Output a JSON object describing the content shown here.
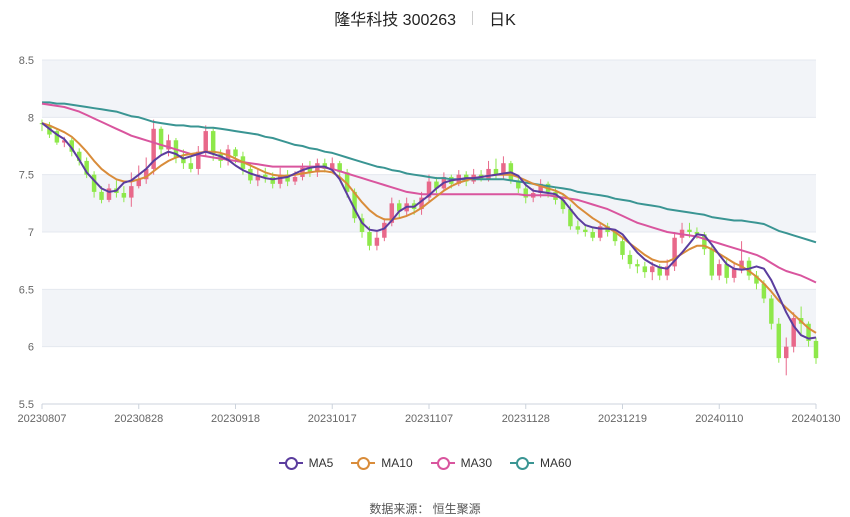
{
  "header": {
    "title": "隆华科技 300263",
    "period": "日K"
  },
  "source_text": "数据来源： 恒生聚源",
  "colors": {
    "up": "#e8688a",
    "down": "#8ee84a",
    "ma5": "#5b3d9e",
    "ma10": "#d98c3a",
    "ma30": "#d9559e",
    "ma60": "#3a9593",
    "band": "#f2f4f8",
    "grid": "#e4e8ef"
  },
  "chart_data": {
    "type": "candlestick",
    "title": "隆华科技 300263",
    "ylim": [
      5.5,
      8.5
    ],
    "yticks": [
      "5.5",
      "6",
      "6.5",
      "7",
      "7.5",
      "8",
      "8.5"
    ],
    "xtick_labels": [
      "20230807",
      "20230828",
      "20230918",
      "20231017",
      "20231107",
      "20231128",
      "20231219",
      "20240110",
      "20240130"
    ],
    "legend": [
      "MA5",
      "MA10",
      "MA30",
      "MA60"
    ],
    "candles": [
      [
        7.95,
        7.94,
        7.98,
        7.88
      ],
      [
        7.93,
        7.85,
        7.96,
        7.82
      ],
      [
        7.88,
        7.78,
        7.9,
        7.76
      ],
      [
        7.78,
        7.8,
        7.83,
        7.74
      ],
      [
        7.8,
        7.7,
        7.82,
        7.66
      ],
      [
        7.7,
        7.62,
        7.73,
        7.58
      ],
      [
        7.62,
        7.5,
        7.65,
        7.47
      ],
      [
        7.5,
        7.35,
        7.53,
        7.3
      ],
      [
        7.35,
        7.28,
        7.4,
        7.25
      ],
      [
        7.28,
        7.38,
        7.42,
        7.26
      ],
      [
        7.38,
        7.34,
        7.45,
        7.3
      ],
      [
        7.34,
        7.3,
        7.4,
        7.26
      ],
      [
        7.3,
        7.4,
        7.52,
        7.22
      ],
      [
        7.4,
        7.46,
        7.58,
        7.38
      ],
      [
        7.46,
        7.55,
        7.65,
        7.42
      ],
      [
        7.55,
        7.9,
        7.98,
        7.5
      ],
      [
        7.9,
        7.72,
        7.92,
        7.68
      ],
      [
        7.72,
        7.8,
        7.85,
        7.66
      ],
      [
        7.8,
        7.65,
        7.82,
        7.6
      ],
      [
        7.65,
        7.6,
        7.72,
        7.55
      ],
      [
        7.6,
        7.55,
        7.66,
        7.52
      ],
      [
        7.55,
        7.7,
        7.75,
        7.5
      ],
      [
        7.7,
        7.88,
        7.93,
        7.66
      ],
      [
        7.88,
        7.68,
        7.9,
        7.62
      ],
      [
        7.68,
        7.62,
        7.72,
        7.56
      ],
      [
        7.62,
        7.72,
        7.76,
        7.58
      ],
      [
        7.72,
        7.66,
        7.74,
        7.6
      ],
      [
        7.66,
        7.55,
        7.7,
        7.5
      ],
      [
        7.55,
        7.45,
        7.6,
        7.42
      ],
      [
        7.45,
        7.5,
        7.55,
        7.4
      ],
      [
        7.5,
        7.48,
        7.56,
        7.43
      ],
      [
        7.48,
        7.42,
        7.52,
        7.38
      ],
      [
        7.42,
        7.5,
        7.56,
        7.38
      ],
      [
        7.5,
        7.44,
        7.54,
        7.4
      ],
      [
        7.44,
        7.48,
        7.53,
        7.41
      ],
      [
        7.48,
        7.56,
        7.6,
        7.45
      ],
      [
        7.56,
        7.52,
        7.62,
        7.48
      ],
      [
        7.52,
        7.6,
        7.64,
        7.48
      ],
      [
        7.6,
        7.55,
        7.64,
        7.52
      ],
      [
        7.55,
        7.6,
        7.65,
        7.52
      ],
      [
        7.6,
        7.52,
        7.62,
        7.48
      ],
      [
        7.52,
        7.35,
        7.55,
        7.3
      ],
      [
        7.35,
        7.12,
        7.38,
        7.08
      ],
      [
        7.12,
        7.0,
        7.16,
        6.95
      ],
      [
        7.0,
        6.88,
        7.05,
        6.84
      ],
      [
        6.88,
        6.95,
        7.0,
        6.84
      ],
      [
        6.95,
        7.08,
        7.12,
        6.92
      ],
      [
        7.08,
        7.25,
        7.3,
        7.05
      ],
      [
        7.25,
        7.18,
        7.28,
        7.12
      ],
      [
        7.18,
        7.25,
        7.3,
        7.14
      ],
      [
        7.25,
        7.2,
        7.28,
        7.15
      ],
      [
        7.2,
        7.3,
        7.35,
        7.15
      ],
      [
        7.3,
        7.44,
        7.5,
        7.26
      ],
      [
        7.44,
        7.38,
        7.48,
        7.34
      ],
      [
        7.38,
        7.48,
        7.52,
        7.36
      ],
      [
        7.48,
        7.42,
        7.5,
        7.38
      ],
      [
        7.42,
        7.5,
        7.54,
        7.4
      ],
      [
        7.5,
        7.44,
        7.53,
        7.4
      ],
      [
        7.44,
        7.5,
        7.55,
        7.42
      ],
      [
        7.5,
        7.46,
        7.54,
        7.44
      ],
      [
        7.46,
        7.55,
        7.62,
        7.44
      ],
      [
        7.55,
        7.5,
        7.64,
        7.46
      ],
      [
        7.5,
        7.6,
        7.66,
        7.46
      ],
      [
        7.6,
        7.45,
        7.62,
        7.42
      ],
      [
        7.45,
        7.38,
        7.48,
        7.34
      ],
      [
        7.38,
        7.3,
        7.42,
        7.25
      ],
      [
        7.3,
        7.34,
        7.38,
        7.26
      ],
      [
        7.34,
        7.42,
        7.46,
        7.3
      ],
      [
        7.42,
        7.35,
        7.44,
        7.3
      ],
      [
        7.35,
        7.28,
        7.38,
        7.24
      ],
      [
        7.28,
        7.2,
        7.32,
        7.16
      ],
      [
        7.2,
        7.05,
        7.24,
        7.02
      ],
      [
        7.05,
        7.02,
        7.1,
        6.98
      ],
      [
        7.02,
        7.0,
        7.06,
        6.96
      ],
      [
        7.0,
        6.95,
        7.04,
        6.92
      ],
      [
        6.95,
        7.05,
        7.08,
        6.92
      ],
      [
        7.05,
        7.0,
        7.08,
        6.96
      ],
      [
        7.0,
        6.92,
        7.02,
        6.88
      ],
      [
        6.92,
        6.8,
        6.95,
        6.76
      ],
      [
        6.8,
        6.72,
        6.84,
        6.68
      ],
      [
        6.72,
        6.7,
        6.76,
        6.64
      ],
      [
        6.7,
        6.65,
        6.74,
        6.6
      ],
      [
        6.65,
        6.7,
        6.74,
        6.58
      ],
      [
        6.7,
        6.62,
        6.72,
        6.58
      ],
      [
        6.62,
        6.7,
        6.76,
        6.58
      ],
      [
        6.7,
        6.95,
        7.0,
        6.66
      ],
      [
        6.95,
        7.02,
        7.08,
        6.9
      ],
      [
        7.02,
        7.0,
        7.08,
        6.95
      ],
      [
        7.0,
        6.98,
        7.04,
        6.94
      ],
      [
        6.98,
        6.85,
        7.0,
        6.8
      ],
      [
        6.85,
        6.62,
        6.88,
        6.58
      ],
      [
        6.62,
        6.72,
        6.76,
        6.58
      ],
      [
        6.72,
        6.6,
        6.78,
        6.55
      ],
      [
        6.6,
        6.68,
        6.74,
        6.56
      ],
      [
        6.68,
        6.75,
        6.92,
        6.64
      ],
      [
        6.75,
        6.62,
        6.78,
        6.58
      ],
      [
        6.62,
        6.55,
        6.66,
        6.5
      ],
      [
        6.55,
        6.42,
        6.58,
        6.38
      ],
      [
        6.42,
        6.2,
        6.45,
        6.15
      ],
      [
        6.2,
        5.9,
        6.25,
        5.86
      ],
      [
        5.9,
        6.0,
        6.08,
        5.75
      ],
      [
        6.0,
        6.25,
        6.3,
        5.95
      ],
      [
        6.25,
        6.2,
        6.35,
        6.1
      ],
      [
        6.2,
        6.05,
        6.22,
        6.0
      ],
      [
        6.05,
        5.9,
        6.08,
        5.85
      ]
    ],
    "ma5": [
      7.95,
      7.9,
      7.85,
      7.81,
      7.73,
      7.63,
      7.52,
      7.45,
      7.38,
      7.35,
      7.36,
      7.43,
      7.45,
      7.5,
      7.55,
      7.62,
      7.67,
      7.7,
      7.68,
      7.64,
      7.66,
      7.68,
      7.7,
      7.68,
      7.66,
      7.63,
      7.58,
      7.54,
      7.51,
      7.49,
      7.47,
      7.46,
      7.47,
      7.48,
      7.51,
      7.54,
      7.56,
      7.57,
      7.57,
      7.54,
      7.46,
      7.33,
      7.2,
      7.08,
      7.02,
      7.01,
      7.03,
      7.1,
      7.18,
      7.22,
      7.22,
      7.27,
      7.32,
      7.38,
      7.43,
      7.45,
      7.46,
      7.47,
      7.47,
      7.48,
      7.49,
      7.5,
      7.51,
      7.52,
      7.49,
      7.41,
      7.36,
      7.35,
      7.34,
      7.33,
      7.28,
      7.2,
      7.12,
      7.06,
      7.04,
      7.03,
      7.03,
      7.02,
      6.98,
      6.9,
      6.82,
      6.76,
      6.72,
      6.69,
      6.68,
      6.75,
      6.82,
      6.9,
      6.98,
      6.97,
      6.89,
      6.8,
      6.72,
      6.68,
      6.67,
      6.68,
      6.7,
      6.68,
      6.58,
      6.44,
      6.3,
      6.18,
      6.1,
      6.07,
      6.08
    ],
    "ma10": [
      7.95,
      7.93,
      7.9,
      7.87,
      7.83,
      7.77,
      7.7,
      7.62,
      7.55,
      7.5,
      7.46,
      7.44,
      7.44,
      7.46,
      7.48,
      7.53,
      7.58,
      7.62,
      7.65,
      7.67,
      7.68,
      7.69,
      7.7,
      7.7,
      7.69,
      7.67,
      7.64,
      7.61,
      7.58,
      7.55,
      7.52,
      7.5,
      7.49,
      7.49,
      7.5,
      7.51,
      7.52,
      7.53,
      7.53,
      7.52,
      7.48,
      7.42,
      7.34,
      7.26,
      7.19,
      7.14,
      7.11,
      7.11,
      7.12,
      7.14,
      7.17,
      7.21,
      7.26,
      7.31,
      7.36,
      7.4,
      7.43,
      7.45,
      7.47,
      7.48,
      7.49,
      7.5,
      7.5,
      7.5,
      7.48,
      7.45,
      7.42,
      7.4,
      7.38,
      7.36,
      7.33,
      7.28,
      7.22,
      7.17,
      7.12,
      7.08,
      7.04,
      7.0,
      6.95,
      6.9,
      6.85,
      6.8,
      6.76,
      6.74,
      6.74,
      6.77,
      6.81,
      6.85,
      6.88,
      6.88,
      6.85,
      6.81,
      6.77,
      6.73,
      6.7,
      6.66,
      6.61,
      6.55,
      6.48,
      6.4,
      6.34,
      6.28,
      6.22,
      6.16,
      6.12
    ],
    "ma30": [
      8.12,
      8.11,
      8.1,
      8.09,
      8.07,
      8.05,
      8.02,
      7.99,
      7.96,
      7.93,
      7.9,
      7.87,
      7.84,
      7.82,
      7.8,
      7.78,
      7.76,
      7.74,
      7.72,
      7.7,
      7.68,
      7.67,
      7.66,
      7.65,
      7.64,
      7.63,
      7.62,
      7.61,
      7.6,
      7.59,
      7.58,
      7.57,
      7.57,
      7.57,
      7.57,
      7.57,
      7.57,
      7.57,
      7.56,
      7.55,
      7.53,
      7.51,
      7.49,
      7.47,
      7.45,
      7.43,
      7.41,
      7.39,
      7.37,
      7.35,
      7.34,
      7.33,
      7.33,
      7.33,
      7.33,
      7.33,
      7.33,
      7.33,
      7.33,
      7.33,
      7.33,
      7.33,
      7.33,
      7.33,
      7.33,
      7.32,
      7.32,
      7.32,
      7.32,
      7.31,
      7.3,
      7.29,
      7.28,
      7.26,
      7.24,
      7.22,
      7.2,
      7.17,
      7.14,
      7.11,
      7.08,
      7.06,
      7.04,
      7.02,
      7.0,
      6.99,
      6.98,
      6.97,
      6.96,
      6.94,
      6.92,
      6.9,
      6.88,
      6.86,
      6.84,
      6.82,
      6.8,
      6.77,
      6.73,
      6.69,
      6.66,
      6.64,
      6.62,
      6.59,
      6.56
    ],
    "ma60": [
      8.13,
      8.13,
      8.12,
      8.12,
      8.11,
      8.1,
      8.09,
      8.08,
      8.07,
      8.06,
      8.05,
      8.03,
      8.01,
      8.0,
      7.98,
      7.96,
      7.95,
      7.94,
      7.93,
      7.93,
      7.92,
      7.92,
      7.91,
      7.91,
      7.9,
      7.89,
      7.88,
      7.87,
      7.86,
      7.85,
      7.83,
      7.82,
      7.8,
      7.78,
      7.76,
      7.75,
      7.73,
      7.72,
      7.7,
      7.69,
      7.67,
      7.65,
      7.63,
      7.61,
      7.59,
      7.57,
      7.56,
      7.54,
      7.53,
      7.51,
      7.5,
      7.49,
      7.48,
      7.47,
      7.47,
      7.46,
      7.46,
      7.46,
      7.46,
      7.46,
      7.46,
      7.46,
      7.46,
      7.45,
      7.44,
      7.43,
      7.42,
      7.41,
      7.4,
      7.39,
      7.38,
      7.37,
      7.35,
      7.34,
      7.33,
      7.32,
      7.31,
      7.29,
      7.28,
      7.27,
      7.25,
      7.24,
      7.23,
      7.22,
      7.2,
      7.19,
      7.18,
      7.17,
      7.16,
      7.15,
      7.13,
      7.12,
      7.11,
      7.1,
      7.1,
      7.09,
      7.08,
      7.07,
      7.04,
      7.01,
      6.99,
      6.97,
      6.95,
      6.93,
      6.91
    ]
  }
}
